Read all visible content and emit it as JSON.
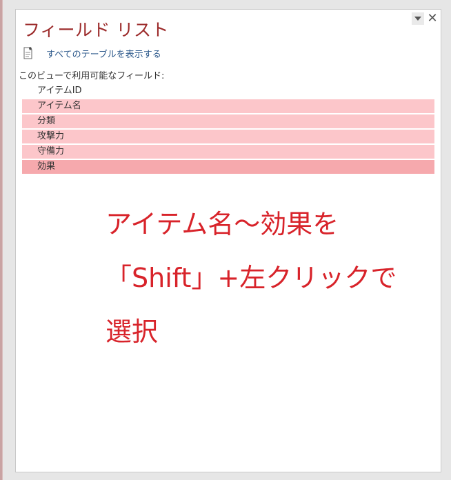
{
  "pane": {
    "title": "フィールド リスト",
    "close_glyph": "✕",
    "show_all_tables_label": "すべてのテーブルを表示する",
    "fields_caption": "このビューで利用可能なフィールド:"
  },
  "fields": [
    {
      "label": "アイテムID",
      "state": "normal"
    },
    {
      "label": "アイテム名",
      "state": "selected"
    },
    {
      "label": "分類",
      "state": "selected"
    },
    {
      "label": "攻撃力",
      "state": "selected"
    },
    {
      "label": "守備力",
      "state": "selected"
    },
    {
      "label": "効果",
      "state": "focused"
    }
  ],
  "annotation": {
    "line1": "アイテム名～効果を",
    "line2": "「Shift」+左クリックで",
    "line3": "選択"
  },
  "colors": {
    "title": "#9c2b2b",
    "link": "#2e5a8c",
    "selected_row": "#fcc6ca",
    "focused_row": "#f6a9ad",
    "annotation": "#d8232a"
  },
  "icons": {
    "dropdown": "dropdown-arrow-icon",
    "close": "close-icon",
    "show_all": "document-add-icon"
  }
}
